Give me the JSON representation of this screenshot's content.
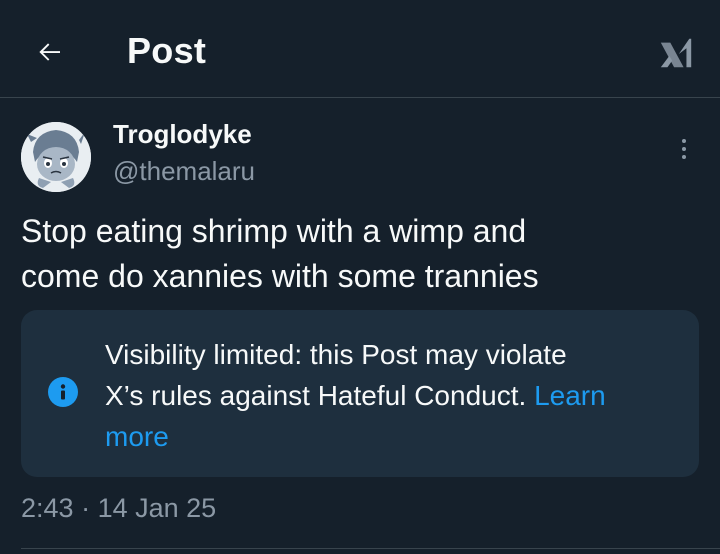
{
  "header": {
    "title": "Post",
    "back_icon": "arrow-left-icon",
    "grok_icon": "grok-icon"
  },
  "author": {
    "display_name": "Troglodyke",
    "handle": "@themalaru",
    "avatar_icon": "avatar-illustration"
  },
  "post": {
    "line1": "Stop eating shrimp with a wimp and",
    "line2": "come do xannies with some trannies"
  },
  "notice": {
    "icon": "info-icon",
    "line1": "Visibility limited: this Post may violate",
    "line2_text": "X’s rules against Hateful Conduct.",
    "link_part1": "Learn",
    "link_part2": "more"
  },
  "meta": {
    "time": "2:43",
    "separator": "·",
    "date": "14 Jan 25"
  },
  "colors": {
    "background": "#15202b",
    "text": "#f7f9f9",
    "secondary_text": "#8b98a5",
    "accent": "#1d9bf0",
    "notice_bg": "#1e2f3e",
    "divider": "#38444d"
  }
}
